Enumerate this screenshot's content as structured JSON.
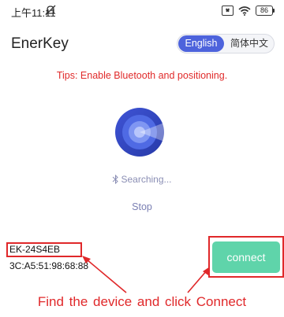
{
  "status_bar": {
    "time": "上午11:11",
    "icons": [
      "mute-icon",
      "sim-icon",
      "wifi-icon",
      "battery-icon"
    ],
    "battery_level": "86"
  },
  "header": {
    "title": "EnerKey",
    "language_toggle": {
      "active_label": "English",
      "inactive_label": "简体中文"
    }
  },
  "tips": "Tips: Enable Bluetooth and positioning.",
  "scan": {
    "logo_icon": "scan-radar-icon",
    "status_icon": "bluetooth-icon",
    "status_text": "Searching...",
    "stop_label": "Stop"
  },
  "device": {
    "name": "EK-24S4EB",
    "mac": "3C:A5:51:98:68:88",
    "connect_label": "connect"
  },
  "annotation": {
    "instruction": "Find the device and click Connect"
  },
  "colors": {
    "accent": "#4d63dc",
    "tips_red": "#e02a2a",
    "connect_green": "#5fd4aa",
    "muted_text": "#8a8eb4"
  }
}
